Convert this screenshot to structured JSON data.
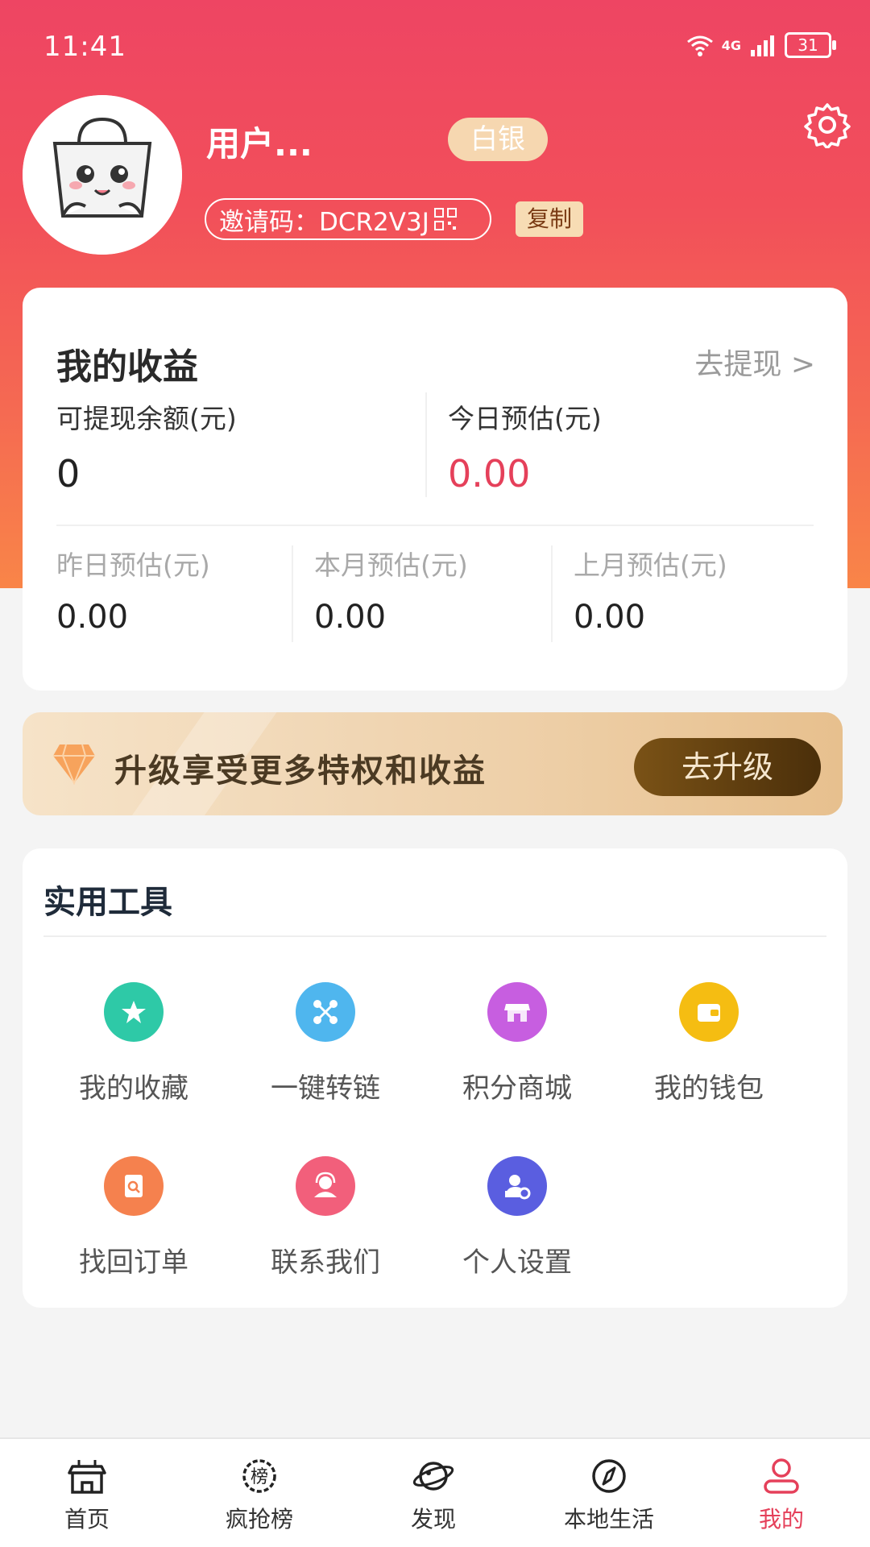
{
  "status_bar": {
    "time": "11:41",
    "network": "4G",
    "battery": "31"
  },
  "profile": {
    "username": "用户...",
    "level": "白银",
    "invite_label": "邀请码：DCR2V3J",
    "copy_label": "复制"
  },
  "earnings": {
    "title": "我的收益",
    "withdraw_link": "去提现 >",
    "balance_label": "可提现余额(元)",
    "balance_value": "0",
    "today_label": "今日预估(元)",
    "today_value": "0.00",
    "yesterday_label": "昨日预估(元)",
    "yesterday_value": "0.00",
    "month_label": "本月预估(元)",
    "month_value": "0.00",
    "last_month_label": "上月预估(元)",
    "last_month_value": "0.00"
  },
  "upgrade": {
    "text": "升级享受更多特权和收益",
    "button": "去升级"
  },
  "tools": {
    "title": "实用工具",
    "items": [
      {
        "label": "我的收藏",
        "icon": "star-icon",
        "color": "#2ec9a7"
      },
      {
        "label": "一键转链",
        "icon": "link-nodes-icon",
        "color": "#4fb6ee"
      },
      {
        "label": "积分商城",
        "icon": "store-icon",
        "color": "#c75ee0"
      },
      {
        "label": "我的钱包",
        "icon": "wallet-icon",
        "color": "#f5bd12"
      },
      {
        "label": "找回订单",
        "icon": "order-search-icon",
        "color": "#f5814e"
      },
      {
        "label": "联系我们",
        "icon": "customer-service-icon",
        "color": "#f25f7b"
      },
      {
        "label": "个人设置",
        "icon": "user-settings-icon",
        "color": "#5a5ee0"
      }
    ]
  },
  "tabbar": {
    "items": [
      {
        "label": "首页",
        "icon": "home-shop-icon"
      },
      {
        "label": "疯抢榜",
        "icon": "ranking-badge-icon"
      },
      {
        "label": "发现",
        "icon": "planet-icon"
      },
      {
        "label": "本地生活",
        "icon": "compass-icon"
      },
      {
        "label": "我的",
        "icon": "profile-icon"
      }
    ],
    "active": "我的",
    "active_color": "#e5405a"
  }
}
